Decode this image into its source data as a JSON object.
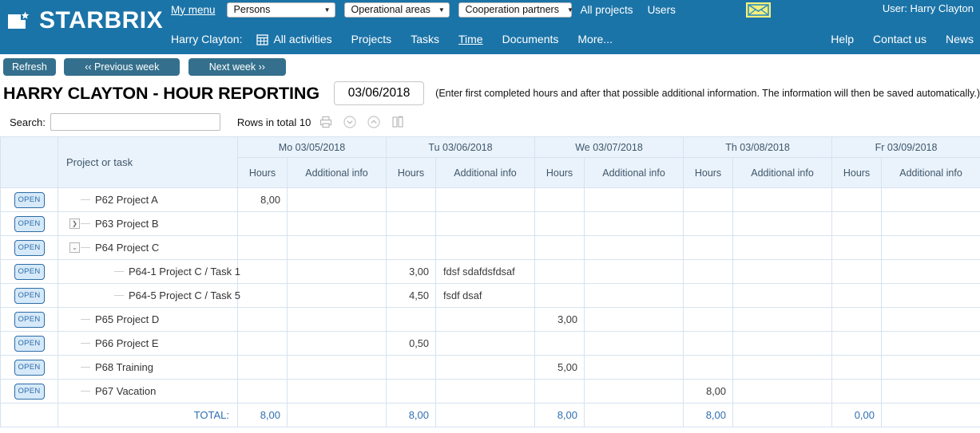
{
  "app": {
    "brand": "STARBRIX",
    "logo_icon": "starbrix-logo-icon"
  },
  "header": {
    "my_menu": "My menu",
    "selects": [
      {
        "name": "persons",
        "value": "Persons",
        "caret": "▼"
      },
      {
        "name": "operational-areas",
        "value": "Operational areas",
        "caret": "▼"
      },
      {
        "name": "cooperation-partners",
        "value": "Cooperation partners",
        "caret": "▼"
      }
    ],
    "top_links": [
      {
        "name": "all-projects",
        "label": "All projects"
      },
      {
        "name": "users",
        "label": "Users"
      }
    ],
    "mail_icon": "envelope-icon",
    "user_label": "User: Harry Clayton",
    "user_prefix": "Harry Clayton:",
    "nav": [
      {
        "name": "all-activities",
        "label": "All activities",
        "icon": "calendar-grid-icon",
        "active": false
      },
      {
        "name": "projects",
        "label": "Projects",
        "active": false
      },
      {
        "name": "tasks",
        "label": "Tasks",
        "active": false
      },
      {
        "name": "time",
        "label": "Time",
        "active": true
      },
      {
        "name": "documents",
        "label": "Documents",
        "active": false
      },
      {
        "name": "more",
        "label": "More...",
        "active": false
      }
    ],
    "nav_right": [
      {
        "name": "help",
        "label": "Help"
      },
      {
        "name": "contact-us",
        "label": "Contact us"
      },
      {
        "name": "news",
        "label": "News"
      }
    ]
  },
  "toolbar": {
    "refresh": "Refresh",
    "previous_week": "‹‹  Previous week",
    "next_week": "Next week  ››"
  },
  "page": {
    "title": "HARRY CLAYTON - HOUR REPORTING",
    "date_value": "03/06/2018",
    "hint": "(Enter first completed hours and after that possible additional information. The information will then be saved automatically.)"
  },
  "search": {
    "label": "Search:",
    "value": "",
    "placeholder": "",
    "rows_total": "Rows in total 10",
    "icons": [
      {
        "name": "print-icon"
      },
      {
        "name": "expand-all-icon"
      },
      {
        "name": "collapse-all-icon"
      },
      {
        "name": "columns-icon"
      }
    ]
  },
  "table": {
    "col_project": "Project or task",
    "open_label": "OPEN",
    "days": [
      {
        "name": "monday",
        "label": "Mo 03/05/2018",
        "hours": "Hours",
        "info": "Additional info"
      },
      {
        "name": "tuesday",
        "label": "Tu 03/06/2018",
        "hours": "Hours",
        "info": "Additional info"
      },
      {
        "name": "wednesday",
        "label": "We 03/07/2018",
        "hours": "Hours",
        "info": "Additional info"
      },
      {
        "name": "thursday",
        "label": "Th 03/08/2018",
        "hours": "Hours",
        "info": "Additional info"
      },
      {
        "name": "friday",
        "label": "Fr 03/09/2018",
        "hours": "Hours",
        "info": "Additional info"
      }
    ],
    "rows": [
      {
        "name": "P62 Project A",
        "level": 0,
        "toggle": "none",
        "cells": [
          [
            "8,00",
            ""
          ],
          [
            "",
            ""
          ],
          [
            "",
            ""
          ],
          [
            "",
            ""
          ],
          [
            "",
            ""
          ]
        ]
      },
      {
        "name": "P63 Project B",
        "level": 0,
        "toggle": "collapsed",
        "cells": [
          [
            "",
            ""
          ],
          [
            "",
            ""
          ],
          [
            "",
            ""
          ],
          [
            "",
            ""
          ],
          [
            "",
            ""
          ]
        ]
      },
      {
        "name": "P64 Project C",
        "level": 0,
        "toggle": "expanded",
        "cells": [
          [
            "",
            ""
          ],
          [
            "",
            ""
          ],
          [
            "",
            ""
          ],
          [
            "",
            ""
          ],
          [
            "",
            ""
          ]
        ]
      },
      {
        "name": "P64-1 Project C / Task 1",
        "level": 1,
        "toggle": "none",
        "cells": [
          [
            "",
            ""
          ],
          [
            "3,00",
            "fdsf sdafdsfdsaf"
          ],
          [
            "",
            ""
          ],
          [
            "",
            ""
          ],
          [
            "",
            ""
          ]
        ]
      },
      {
        "name": "P64-5 Project C / Task 5",
        "level": 1,
        "toggle": "none",
        "cells": [
          [
            "",
            ""
          ],
          [
            "4,50",
            "fsdf dsaf"
          ],
          [
            "",
            ""
          ],
          [
            "",
            ""
          ],
          [
            "",
            ""
          ]
        ]
      },
      {
        "name": "P65 Project D",
        "level": 0,
        "toggle": "none",
        "cells": [
          [
            "",
            ""
          ],
          [
            "",
            ""
          ],
          [
            "3,00",
            ""
          ],
          [
            "",
            ""
          ],
          [
            "",
            ""
          ]
        ]
      },
      {
        "name": "P66 Project E",
        "level": 0,
        "toggle": "none",
        "cells": [
          [
            "",
            ""
          ],
          [
            "0,50",
            ""
          ],
          [
            "",
            ""
          ],
          [
            "",
            ""
          ],
          [
            "",
            ""
          ]
        ]
      },
      {
        "name": "P68 Training",
        "level": 0,
        "toggle": "none",
        "cells": [
          [
            "",
            ""
          ],
          [
            "",
            ""
          ],
          [
            "5,00",
            ""
          ],
          [
            "",
            ""
          ],
          [
            "",
            ""
          ]
        ]
      },
      {
        "name": "P67 Vacation",
        "level": 0,
        "toggle": "none",
        "cells": [
          [
            "",
            ""
          ],
          [
            "",
            ""
          ],
          [
            "",
            ""
          ],
          [
            "8,00",
            ""
          ],
          [
            "",
            ""
          ]
        ]
      }
    ],
    "total_label": "TOTAL:",
    "totals": [
      "8,00",
      "8,00",
      "8,00",
      "8,00",
      "0,00"
    ]
  },
  "colors": {
    "header_blue": "#1b74a8",
    "button_blue": "#34708d",
    "grid_header": "#eaf3fb",
    "grid_border": "#d5e3f0",
    "total_text": "#2f6fb0",
    "open_border": "#2c6ca8",
    "open_fill": "#d6e9f9",
    "mail_yellow": "#f5f07a"
  }
}
